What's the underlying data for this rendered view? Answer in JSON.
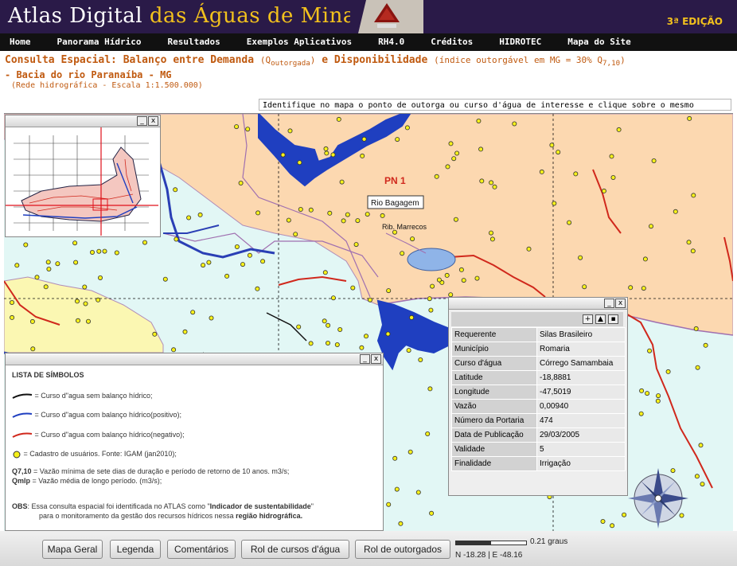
{
  "header": {
    "title_part1": "Atlas Digital",
    "title_part2": "das Águas de Minas",
    "edition": "3ª EDIÇÃO",
    "logo_icon": "university-logo-icon"
  },
  "nav": [
    {
      "label": "Home"
    },
    {
      "label": "Panorama Hídrico"
    },
    {
      "label": "Resultados"
    },
    {
      "label": "Exemplos Aplicativos"
    },
    {
      "label": "RH4.0"
    },
    {
      "label": "Créditos"
    },
    {
      "label": "HIDROTEC"
    },
    {
      "label": "Mapa do Site"
    }
  ],
  "page": {
    "heading_a": "Consulta Espacial: Balanço entre Demanda",
    "heading_q": "(Q",
    "heading_q_sub": "outorgada",
    "heading_q_close": ")",
    "heading_b": "e Disponibilidade",
    "heading_note": "(índice outorgável em MG = 30% Q",
    "heading_note_sub": "7,10",
    "heading_note_close": ")",
    "subtitle": "- Bacia do rio Paranaíba - MG",
    "subnote": "(Rede hidrográfica - Escala 1:1.500.000)",
    "instruction": "Identifique no mapa o ponto de outorga ou curso d'água de interesse e clique sobre o mesmo"
  },
  "map": {
    "label_pn": "PN 1",
    "label_rio": "Rio Bagagem",
    "label_rib": "Rib. Marrecos"
  },
  "legend": {
    "title": "LISTA DE SÍMBOLOS",
    "items": [
      {
        "text": "= Curso d\"agua sem balanço hídrico;"
      },
      {
        "text": "= Curso d\"agua com balanço hídrico(positivo);"
      },
      {
        "text": "= Curso d\"agua com balanço hídrico(negativo);"
      },
      {
        "text": "= Cadastro de usuários. Fonte: IGAM (jan2010);"
      }
    ],
    "q710_label": "Q7,10",
    "q710_text": "= Vazão mínima de sete dias de duração e período de retorno de 10 anos. m3/s;",
    "qmlp_label": "Qmlp",
    "qmlp_text": "= Vazão média de longo período. (m3/s);",
    "obs_label": "OBS",
    "obs_text1": ": Essa consulta espacial foi identificada no ATLAS como \"",
    "obs_bold1": "Indicador de sustentabilidade",
    "obs_text2": "\"",
    "obs_line2": "para o monitoramento da gestão dos recursos hídricos nessa",
    "obs_bold2": "região hidrográfica."
  },
  "info": {
    "rows": [
      {
        "k": "Requerente",
        "v": "Silas Brasileiro"
      },
      {
        "k": "Município",
        "v": "Romaria"
      },
      {
        "k": "Curso d'água",
        "v": "Córrego Samambaia"
      },
      {
        "k": "Latitude",
        "v": "-18,8881"
      },
      {
        "k": "Longitude",
        "v": "-47,5019"
      },
      {
        "k": "Vazão",
        "v": "0,00940"
      },
      {
        "k": "Número da Portaria",
        "v": "474"
      },
      {
        "k": "Data de Publicação",
        "v": "29/03/2005"
      },
      {
        "k": "Validade",
        "v": "5"
      },
      {
        "k": "Finalidade",
        "v": "Irrigação"
      }
    ]
  },
  "footer": {
    "buttons": [
      {
        "label": "Mapa Geral"
      },
      {
        "label": "Legenda"
      },
      {
        "label": "Comentários"
      },
      {
        "label": "Rol de cursos d'água"
      },
      {
        "label": "Rol de outorgados"
      }
    ],
    "scale": "0.21 graus",
    "coords": "N -18.28 | E -48.16"
  },
  "window_controls": {
    "minimize": "_",
    "close": "x"
  }
}
